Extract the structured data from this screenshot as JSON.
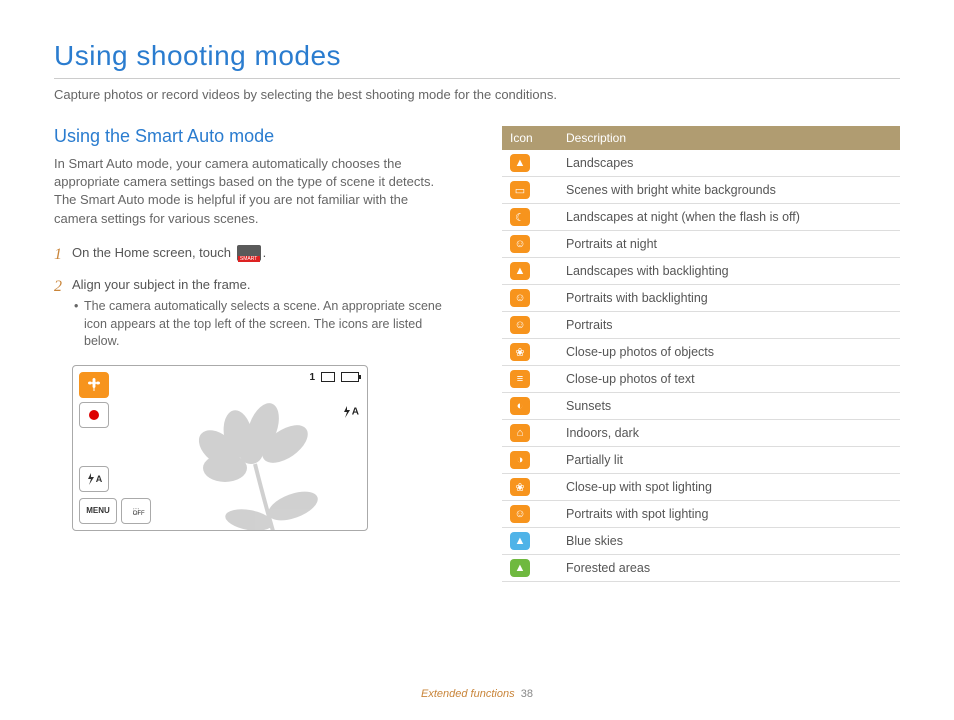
{
  "page": {
    "title": "Using shooting modes",
    "intro": "Capture photos or record videos by selecting the best shooting mode for the conditions."
  },
  "section": {
    "title": "Using the Smart Auto mode",
    "desc": "In Smart Auto mode, your camera automatically chooses the appropriate camera settings based on the type of scene it detects. The Smart Auto mode is helpful if you are not familiar with the camera settings for various scenes."
  },
  "steps": {
    "s1_num": "1",
    "s1_text_a": "On the Home screen, touch ",
    "s1_text_b": ".",
    "s2_num": "2",
    "s2_text": "Align your subject in the frame.",
    "s2_sub": "The camera automatically selects a scene. An appropriate scene icon appears at the top left of the screen. The icons are listed below."
  },
  "lcd": {
    "count": "1",
    "flash": "A",
    "flash2": "A",
    "menu": "MENU",
    "off": "OFF"
  },
  "table": {
    "h1": "Icon",
    "h2": "Description",
    "rows": [
      {
        "glyph": "▲",
        "color": "#f7941d",
        "desc": "Landscapes"
      },
      {
        "glyph": "▭",
        "color": "#f7941d",
        "desc": "Scenes with bright white backgrounds"
      },
      {
        "glyph": "☾",
        "color": "#f7941d",
        "desc": "Landscapes at night (when the flash is off)"
      },
      {
        "glyph": "☺",
        "color": "#f7941d",
        "desc": "Portraits at night"
      },
      {
        "glyph": "▲",
        "color": "#f7941d",
        "desc": "Landscapes with backlighting"
      },
      {
        "glyph": "☺",
        "color": "#f7941d",
        "desc": "Portraits with backlighting"
      },
      {
        "glyph": "☺",
        "color": "#f7941d",
        "desc": "Portraits"
      },
      {
        "glyph": "❀",
        "color": "#f7941d",
        "desc": "Close-up photos of objects"
      },
      {
        "glyph": "≡",
        "color": "#f7941d",
        "desc": "Close-up photos of text"
      },
      {
        "glyph": "◐",
        "color": "#f7941d",
        "desc": "Sunsets"
      },
      {
        "glyph": "⌂",
        "color": "#f7941d",
        "desc": "Indoors, dark"
      },
      {
        "glyph": "◑",
        "color": "#f7941d",
        "desc": "Partially lit"
      },
      {
        "glyph": "❀",
        "color": "#f7941d",
        "desc": "Close-up with spot lighting"
      },
      {
        "glyph": "☺",
        "color": "#f7941d",
        "desc": "Portraits with spot lighting"
      },
      {
        "glyph": "▲",
        "color": "#4fb3e8",
        "desc": "Blue skies"
      },
      {
        "glyph": "▲",
        "color": "#6fb93f",
        "desc": "Forested areas"
      }
    ]
  },
  "footer": {
    "section": "Extended functions",
    "page": "38"
  }
}
